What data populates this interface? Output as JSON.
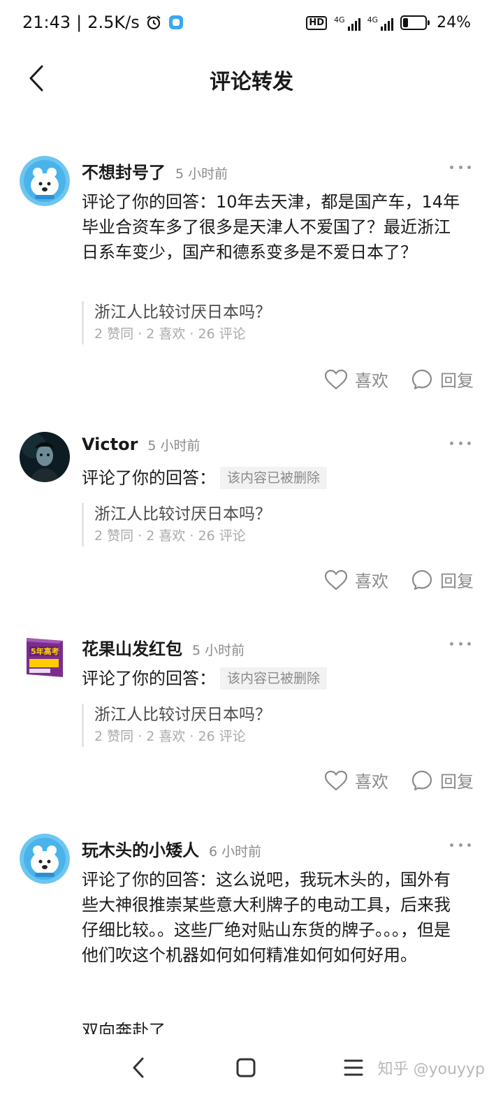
{
  "status_bar": {
    "time": "21:43",
    "divider": "|",
    "speed": "2.5K/s",
    "hd_label": "HD",
    "net1": "4G",
    "net2": "4G",
    "battery_percent": "24%",
    "battery_level": 0.24
  },
  "header": {
    "title": "评论转发",
    "back_icon": "back-arrow-icon"
  },
  "comments": [
    {
      "username": "不想封号了",
      "time": "5 小时前",
      "prefix": "评论了你的回答：",
      "text": "10年去天津，都是国产车，14年毕业合资车多了很多是天津人不爱国了？最近浙江日系车变少，国产和德系变多是不爱日本了？",
      "deleted_label": "",
      "quote_title": "浙江人比较讨厌日本吗？",
      "quote_stats": "2 赞同 · 2 喜欢 · 26 评论",
      "like_label": "喜欢",
      "reply_label": "回复"
    },
    {
      "username": "Victor",
      "time": "5 小时前",
      "prefix": "评论了你的回答：",
      "text": "",
      "deleted_label": "该内容已被删除",
      "quote_title": "浙江人比较讨厌日本吗？",
      "quote_stats": "2 赞同 · 2 喜欢 · 26 评论",
      "like_label": "喜欢",
      "reply_label": "回复"
    },
    {
      "username": "花果山发红包",
      "time": "5 小时前",
      "prefix": "评论了你的回答：",
      "text": "",
      "deleted_label": "该内容已被删除",
      "avatar_text": "5年高考",
      "quote_title": "浙江人比较讨厌日本吗？",
      "quote_stats": "2 赞同 · 2 喜欢 · 26 评论",
      "like_label": "喜欢",
      "reply_label": "回复"
    },
    {
      "username": "玩木头的小矮人",
      "time": "6 小时前",
      "prefix": "评论了你的回答：",
      "text": "这么说吧，我玩木头的，国外有些大神很推崇某些意大利牌子的电动工具，后来我仔细比较。。这些厂绝对贴山东货的牌子。。。，但是他们吹这个机器如何如何精准如何如何好用。",
      "text2": "双向奔赴了"
    }
  ],
  "watermark": "知乎 @youyyp"
}
